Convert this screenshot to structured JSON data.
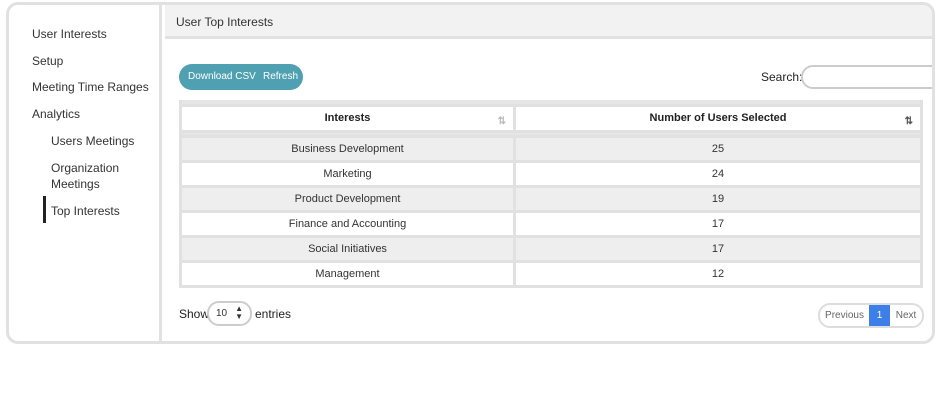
{
  "sidebar": {
    "items": [
      {
        "label": "User Interests"
      },
      {
        "label": "Setup"
      },
      {
        "label": "Meeting Time Ranges"
      },
      {
        "label": "Analytics"
      },
      {
        "label": "Users Meetings"
      },
      {
        "label": "Organization"
      },
      {
        "label": "Meetings"
      },
      {
        "label": "Top Interests"
      }
    ]
  },
  "header": {
    "title": "User Top Interests"
  },
  "toolbar": {
    "download_label": "Download CSV",
    "refresh_label": "Refresh",
    "accent_color": "#4fa0b0"
  },
  "search": {
    "label": "Search:",
    "value": ""
  },
  "table": {
    "columns": [
      "Interests",
      "Number of Users Selected"
    ],
    "rows": [
      [
        "Business Development",
        "25"
      ],
      [
        "Marketing",
        "24"
      ],
      [
        "Product Development",
        "19"
      ],
      [
        "Finance and Accounting",
        "17"
      ],
      [
        "Social Initiatives",
        "17"
      ],
      [
        "Management",
        "12"
      ]
    ]
  },
  "length": {
    "show_label": "Show",
    "value": "10",
    "entries_label": "entries"
  },
  "pagination": {
    "previous": "Previous",
    "current": "1",
    "next": "Next",
    "active_color": "#3d7fe8"
  }
}
